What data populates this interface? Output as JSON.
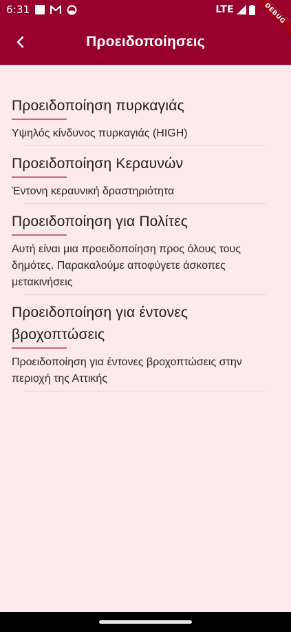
{
  "status_bar": {
    "time": "6:31",
    "network": "LTE",
    "icons": [
      "square-notification-icon",
      "gmail-icon",
      "sync-icon",
      "signal-icon",
      "battery-icon"
    ]
  },
  "debug_banner": "DEBUG",
  "app_bar": {
    "title": "Προειδοποίησεις",
    "back_icon": "chevron-left-icon"
  },
  "colors": {
    "primary": "#98002E",
    "background": "#FBE9EC",
    "underline": "#C6687A"
  },
  "alerts": [
    {
      "title": "Προειδοποίηση πυρκαγιάς",
      "body": "Υψηλός κίνδυνος πυρκαγιάς (HIGH)"
    },
    {
      "title": "Προειδοποίηση Κεραυνών",
      "body": "Έντονη κεραυνική δραστηριότητα"
    },
    {
      "title": "Προειδοποίηση για Πολίτες",
      "body": "Αυτή είναι μια προειδοποίηση προς όλους τους δημότες. Παρακαλούμε αποφύγετε άσκοπες μετακινήσεις"
    },
    {
      "title": "Προειδοποίηση για έντονες βροχοπτώσεις",
      "body": "Προειδοποίηση για έντονες βροχοπτώσεις στην περιοχή της Αττικής"
    }
  ]
}
